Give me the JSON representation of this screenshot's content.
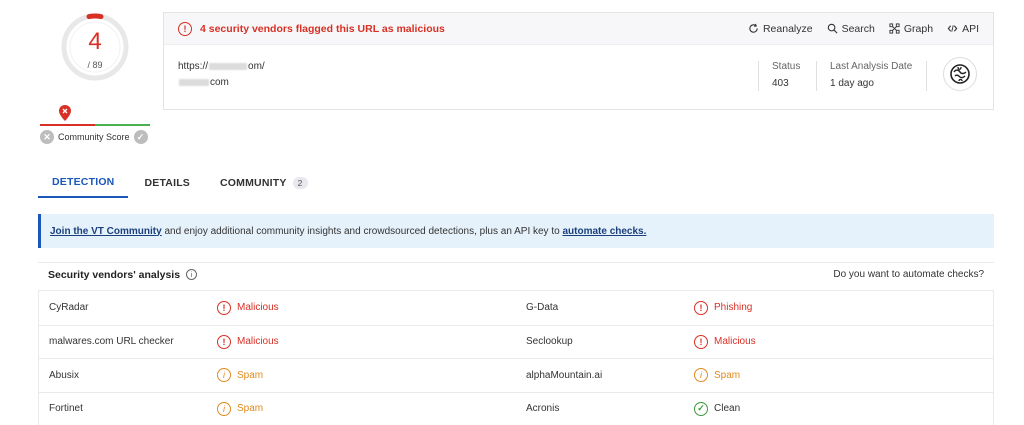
{
  "score": {
    "value": "4",
    "total": "/ 89",
    "community_label": "Community Score",
    "accent": "#d93025"
  },
  "header": {
    "flag_text": "4 security vendors flagged this URL as malicious",
    "actions": [
      {
        "label": "Reanalyze",
        "icon": "reanalyze-icon"
      },
      {
        "label": "Search",
        "icon": "search-icon"
      },
      {
        "label": "Graph",
        "icon": "graph-icon"
      },
      {
        "label": "API",
        "icon": "api-icon"
      }
    ],
    "url_prefix": "https://",
    "url_suffix": "om/",
    "domain_suffix": "com",
    "status_label": "Status",
    "status_value": "403",
    "last_analysis_label": "Last Analysis Date",
    "last_analysis_value": "1 day ago"
  },
  "tabs": [
    {
      "label": "DETECTION",
      "active": true
    },
    {
      "label": "DETAILS",
      "active": false
    },
    {
      "label": "COMMUNITY",
      "active": false,
      "badge": "2"
    }
  ],
  "banner": {
    "link1": "Join the VT Community",
    "middle": " and enjoy additional community insights and crowdsourced detections, plus an API key to ",
    "link2": "automate checks."
  },
  "analysis": {
    "title": "Security vendors' analysis",
    "question": "Do you want to automate checks?",
    "rows": [
      {
        "v1": "CyRadar",
        "r1": "Malicious",
        "t1": "mal",
        "v2": "G-Data",
        "r2": "Phishing",
        "t2": "mal"
      },
      {
        "v1": "malwares.com URL checker",
        "r1": "Malicious",
        "t1": "mal",
        "v2": "Seclookup",
        "r2": "Malicious",
        "t2": "mal"
      },
      {
        "v1": "Abusix",
        "r1": "Spam",
        "t1": "spam",
        "v2": "alphaMountain.ai",
        "r2": "Spam",
        "t2": "spam"
      },
      {
        "v1": "Fortinet",
        "r1": "Spam",
        "t1": "spam",
        "v2": "Acronis",
        "r2": "Clean",
        "t2": "clean"
      }
    ]
  }
}
